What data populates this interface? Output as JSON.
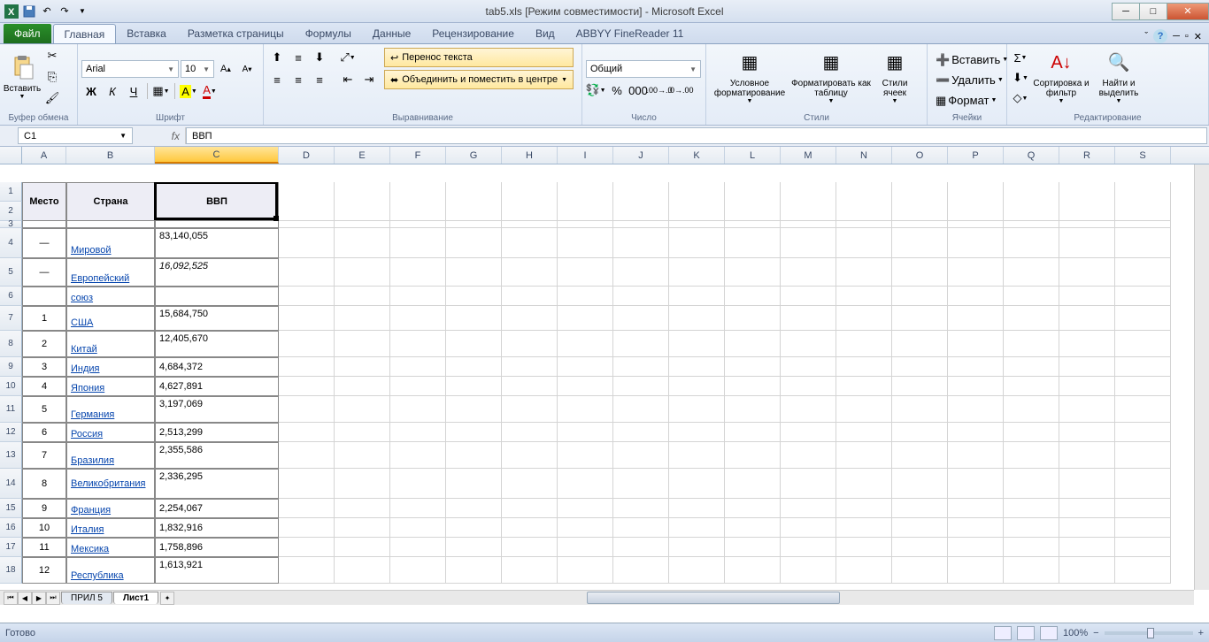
{
  "title": "tab5.xls  [Режим совместимости]  -  Microsoft Excel",
  "tabs": {
    "file": "Файл",
    "list": [
      "Главная",
      "Вставка",
      "Разметка страницы",
      "Формулы",
      "Данные",
      "Рецензирование",
      "Вид",
      "ABBYY FineReader 11"
    ],
    "active": 0
  },
  "ribbon": {
    "clipboard": {
      "paste": "Вставить",
      "label": "Буфер обмена"
    },
    "font": {
      "name": "Arial",
      "size": "10",
      "label": "Шрифт",
      "bold": "Ж",
      "italic": "К",
      "underline": "Ч"
    },
    "align": {
      "wrap": "Перенос текста",
      "merge": "Объединить и поместить в центре",
      "label": "Выравнивание"
    },
    "number": {
      "format": "Общий",
      "label": "Число"
    },
    "styles": {
      "cond": "Условное форматирование",
      "table": "Форматировать как таблицу",
      "cell": "Стили ячеек",
      "label": "Стили"
    },
    "cells": {
      "insert": "Вставить",
      "delete": "Удалить",
      "format": "Формат",
      "label": "Ячейки"
    },
    "editing": {
      "sort": "Сортировка и фильтр",
      "find": "Найти и выделить",
      "label": "Редактирование"
    }
  },
  "namebox": "C1",
  "formula": "ВВП",
  "columns": [
    "A",
    "B",
    "C",
    "D",
    "E",
    "F",
    "G",
    "H",
    "I",
    "J",
    "K",
    "L",
    "M",
    "N",
    "O",
    "P",
    "Q",
    "R",
    "S"
  ],
  "colWidths": {
    "A": 50,
    "B": 100,
    "C": 140,
    "other": 63
  },
  "selectedCol": "C",
  "headerRow": {
    "A": "Место",
    "B": "Страна",
    "C": "ВВП"
  },
  "rows": [
    {
      "n": 4,
      "h": 34,
      "A": "—",
      "B": "Мировой",
      "C": "83,140,055",
      "link": true,
      "italicC": false
    },
    {
      "n": 5,
      "h": 32,
      "A": "—",
      "B": "Европейский",
      "C": "16,092,525",
      "link": true,
      "italicC": true
    },
    {
      "n": 6,
      "h": 22,
      "A": "",
      "B": "союз",
      "C": "",
      "link": true
    },
    {
      "n": 7,
      "h": 28,
      "A": "1",
      "B": "США",
      "C": "15,684,750",
      "link": true
    },
    {
      "n": 8,
      "h": 30,
      "A": "2",
      "B": "Китай",
      "C": "12,405,670",
      "link": true
    },
    {
      "n": 9,
      "h": 22,
      "A": "3",
      "B": "Индия",
      "C": "4,684,372",
      "link": true
    },
    {
      "n": 10,
      "h": 22,
      "A": "4",
      "B": "Япония",
      "C": "4,627,891",
      "link": true
    },
    {
      "n": 11,
      "h": 30,
      "A": "5",
      "B": "Германия",
      "C": "3,197,069",
      "link": true
    },
    {
      "n": 12,
      "h": 22,
      "A": "6",
      "B": "Россия",
      "C": "2,513,299",
      "link": true
    },
    {
      "n": 13,
      "h": 30,
      "A": "7",
      "B": "Бразилия",
      "C": "2,355,586",
      "link": true
    },
    {
      "n": 14,
      "h": 34,
      "A": "8",
      "B": "Великобритания",
      "C": "2,336,295",
      "link": true,
      "wrap": true
    },
    {
      "n": 15,
      "h": 22,
      "A": "9",
      "B": "Франция",
      "C": "2,254,067",
      "link": true
    },
    {
      "n": 16,
      "h": 22,
      "A": "10",
      "B": "Италия",
      "C": "1,832,916",
      "link": true
    },
    {
      "n": 17,
      "h": 22,
      "A": "11",
      "B": "Мексика",
      "C": "1,758,896",
      "link": true
    },
    {
      "n": 18,
      "h": 30,
      "A": "12",
      "B": "Республика",
      "C": "1,613,921",
      "link": true
    }
  ],
  "sheets": {
    "tabs": [
      "ПРИЛ 5",
      "Лист1"
    ],
    "active": 1
  },
  "status": {
    "ready": "Готово",
    "zoom": "100%"
  }
}
